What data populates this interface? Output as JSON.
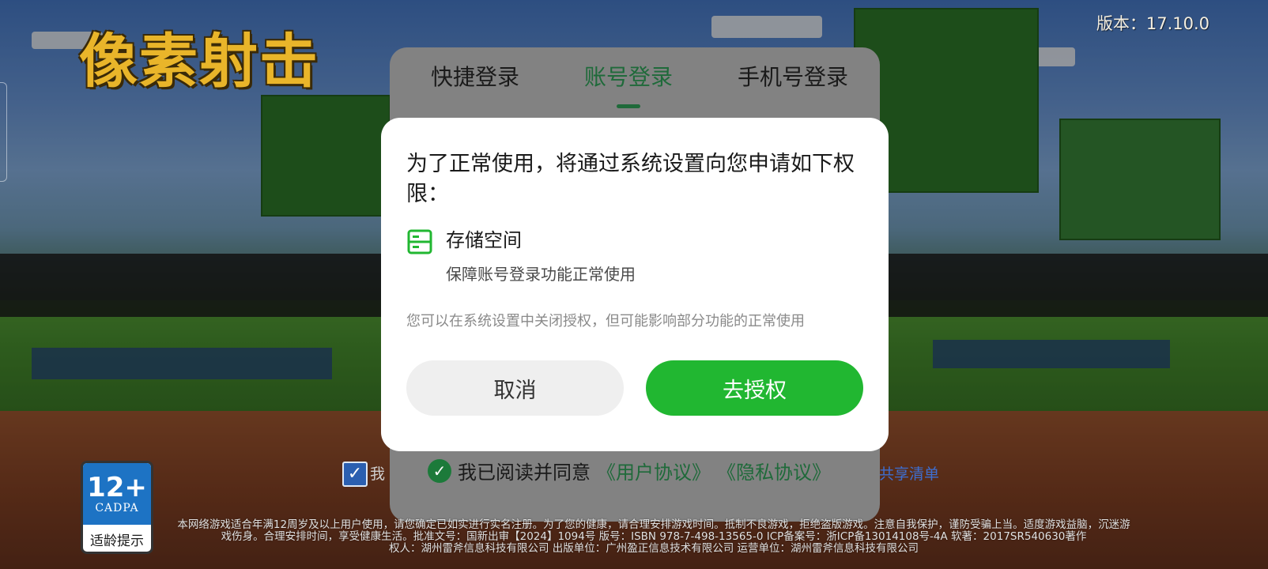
{
  "game": {
    "logo_text": "像素射击",
    "version": "版本：17.10.0"
  },
  "login": {
    "tabs": [
      {
        "label": "快捷登录",
        "active": false
      },
      {
        "label": "账号登录",
        "active": true
      },
      {
        "label": "手机号登录",
        "active": false
      }
    ],
    "agree_check_icon": "checkmark-icon",
    "agree_text": "我已阅读并同意",
    "user_agreement": "《用户协议》",
    "privacy_agreement": "《隐私协议》",
    "accent_color": "#1f6a3a"
  },
  "background": {
    "checkbox_text": "我",
    "share_list": "共享清单"
  },
  "age_rating": {
    "number": "12+",
    "org": "CADPA",
    "label": "适龄提示"
  },
  "footer": {
    "line1": "本网络游戏适合年满12周岁及以上用户使用，请您确定已如实进行实名注册。为了您的健康，请合理安排游戏时间。抵制不良游戏，拒绝盗版游戏。注意自我保护，谨防受骗上当。适度游戏益脑，沉迷游戏伤身。合理安排时间，享受健康生活。批准文号：国新出审【2024】1094号 版号：ISBN 978-7-498-13565-0 ICP备案号：浙ICP备13014108号-4A 软著：2017SR540630著作",
    "line2": "权人：湖州雷斧信息科技有限公司 出版单位：广州盈正信息技术有限公司 运营单位：湖州雷斧信息科技有限公司"
  },
  "dialog": {
    "title": "为了正常使用，将通过系统设置向您申请如下权限：",
    "permission": {
      "icon": "storage-icon",
      "name": "存储空间",
      "description": "保障账号登录功能正常使用"
    },
    "note": "您可以在系统设置中关闭授权，但可能影响部分功能的正常使用",
    "cancel_label": "取消",
    "confirm_label": "去授权",
    "confirm_color": "#21b731"
  }
}
